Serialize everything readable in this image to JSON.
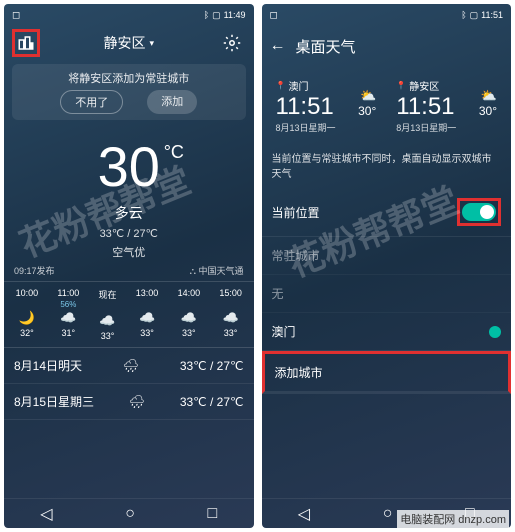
{
  "left": {
    "status_time": "11:49",
    "title": "静安区",
    "banner": "将静安区添加为常驻城市",
    "btn_skip": "不用了",
    "btn_add": "添加",
    "temp": "30",
    "condition": "多云",
    "hi_lo": "33℃ / 27℃",
    "air": "空气优",
    "pub_time": "09:17发布",
    "source": "中国天气通",
    "hourly": [
      {
        "t": "10:00",
        "h": "",
        "i": "🌙",
        "d": "32°"
      },
      {
        "t": "11:00",
        "h": "56%",
        "i": "☁️",
        "d": "31°"
      },
      {
        "t": "现在",
        "h": "",
        "i": "☁️",
        "d": "33°"
      },
      {
        "t": "13:00",
        "h": "",
        "i": "☁️",
        "d": "33°"
      },
      {
        "t": "14:00",
        "h": "",
        "i": "☁️",
        "d": "33°"
      },
      {
        "t": "15:00",
        "h": "",
        "i": "☁️",
        "d": "33°"
      }
    ],
    "daily": [
      {
        "d": "8月14日明天",
        "i": "🌧",
        "r": "33℃ / 27℃"
      },
      {
        "d": "8月15日星期三",
        "i": "🌧",
        "r": "33℃ / 27℃"
      }
    ],
    "watermark": "花粉帮帮堂"
  },
  "right": {
    "status_time": "11:51",
    "title": "桌面天气",
    "cities": [
      {
        "name": "澳门",
        "time": "11:51",
        "date": "8月13日星期一",
        "icon": "⛅",
        "temp": "30°"
      },
      {
        "name": "静安区",
        "time": "11:51",
        "date": "8月13日星期一",
        "icon": "⛅",
        "temp": "30°"
      }
    ],
    "hint": "当前位置与常驻城市不同时，桌面自动显示双城市天气",
    "row_current": "当前位置",
    "row_resident": "常驻城市",
    "row_none": "无",
    "row_macau": "澳门",
    "row_addcity": "添加城市",
    "watermark": "花粉帮帮堂"
  },
  "site": "电脑装配网 dnzp.com"
}
